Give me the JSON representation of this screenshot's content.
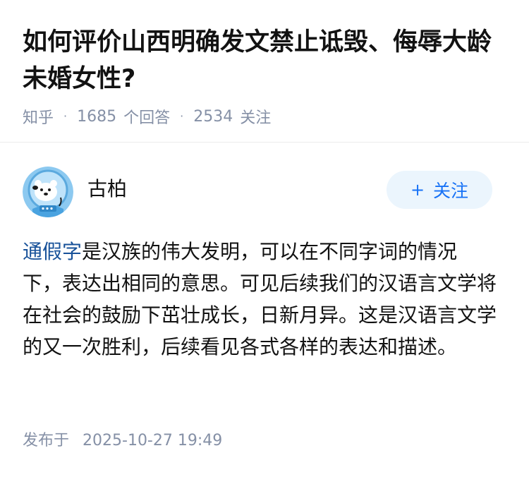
{
  "question": {
    "title": "如何评价山西明确发文禁止诋毁、侮辱大龄未婚女性?",
    "source": "知乎",
    "answer_count": "1685",
    "answer_label": "个回答",
    "follower_count": "2534",
    "follower_label": "关注"
  },
  "answer": {
    "author": {
      "name": "古柏",
      "avatar_icon": "polar-bear-astronaut-avatar"
    },
    "follow_button": {
      "plus": "+",
      "label": "关注"
    },
    "body": {
      "link_text": "通假字",
      "text": "是汉族的伟大发明，可以在不同字词的情况下，表达出相同的意思。可见后续我们的汉语言文学将在社会的鼓励下茁壮成长，日新月异。这是汉语言文学的又一次胜利，后续看见各式各样的表达和描述。"
    },
    "published": {
      "label": "发布于",
      "datetime": "2025-10-27 19:49"
    }
  },
  "colors": {
    "title": "#121212",
    "meta": "#8590a6",
    "link": "#175199",
    "follow_bg": "#ebf5fd",
    "follow_text": "#1772f6"
  }
}
